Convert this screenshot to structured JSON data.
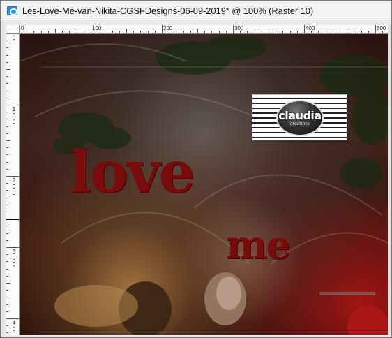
{
  "window": {
    "title": "Les-Love-Me-van-Nikita-CGSFDesigns-06-09-2019* @ 100% (Raster 10)"
  },
  "icons": {
    "app": "paint-shop-pro-app-icon"
  },
  "ruler": {
    "top_labels": [
      "0",
      "100",
      "200",
      "300",
      "400",
      "500"
    ],
    "left_labels": [
      [
        "0"
      ],
      [
        "1",
        "0",
        "0"
      ],
      [
        "2",
        "0",
        "0"
      ],
      [
        "3",
        "0",
        "0"
      ],
      [
        "4",
        "0"
      ]
    ]
  },
  "canvas": {
    "word_love": "love",
    "word_me": "me",
    "watermark_brand": "claudia",
    "watermark_sub": "creations"
  },
  "colors": {
    "text_red": "#7a0b0b",
    "titlebar_bg": "#f3f3f3"
  }
}
